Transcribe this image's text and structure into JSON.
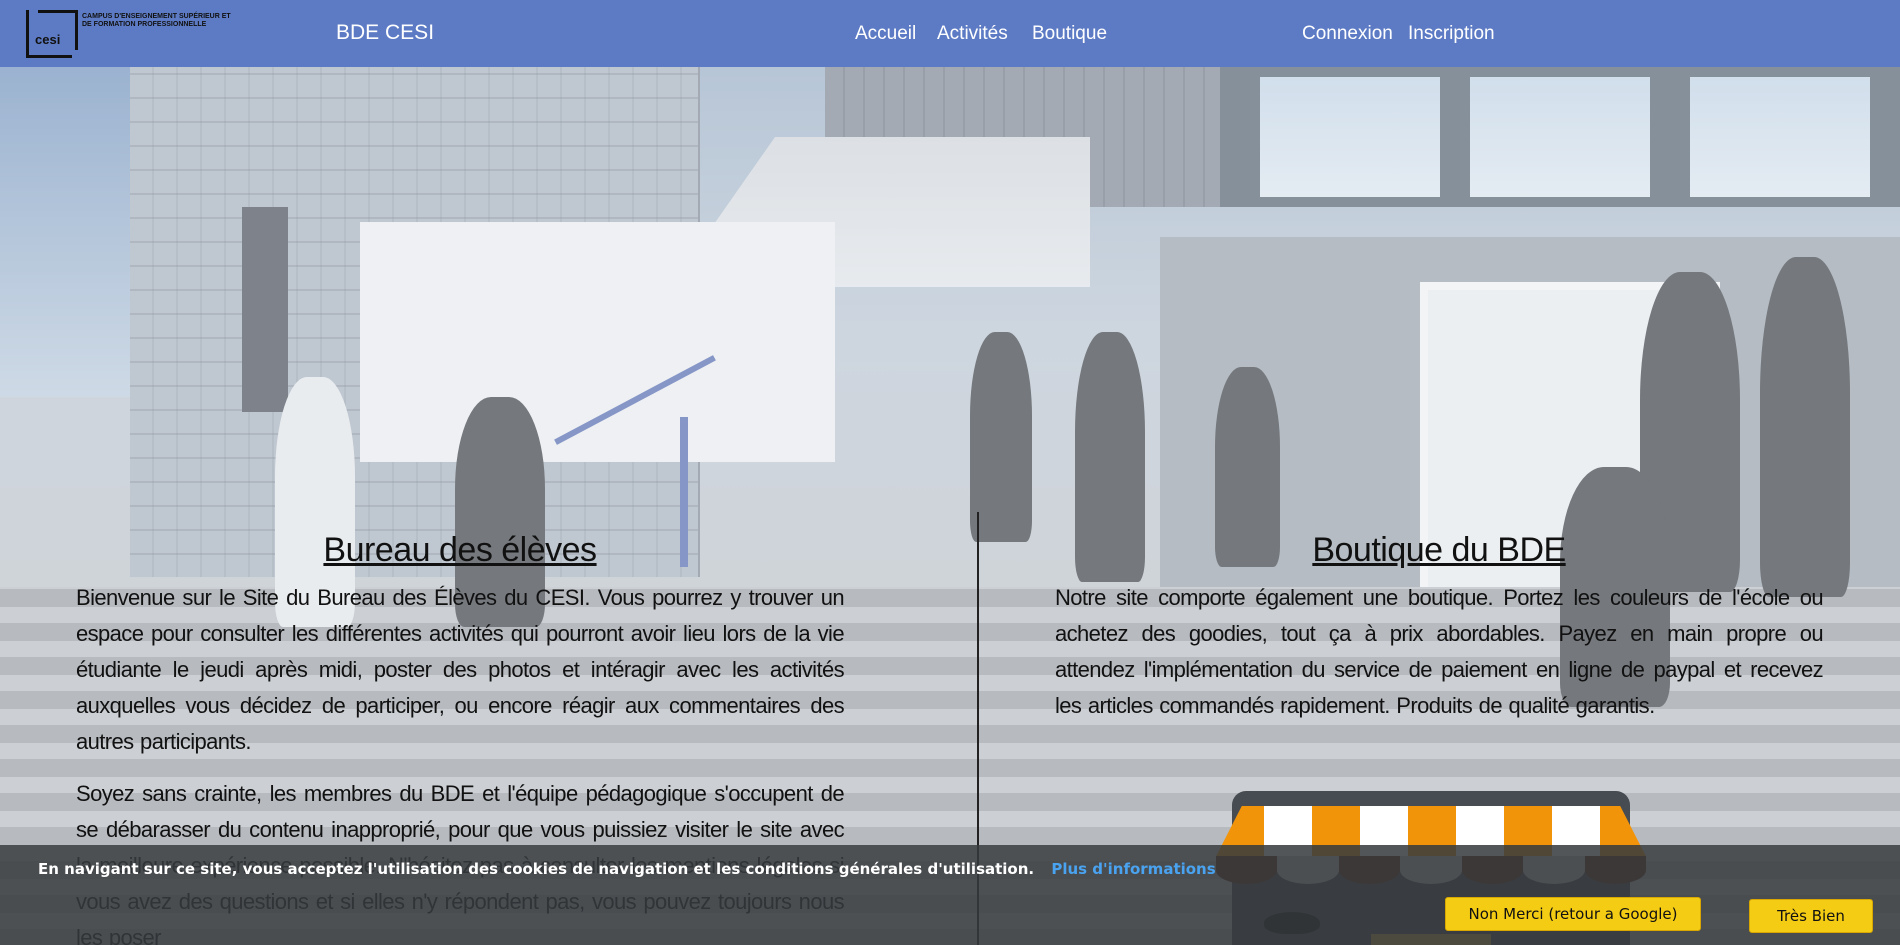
{
  "header": {
    "logo_word": "cesi",
    "logo_tagline": "Campus d'enseignement supérieur et de formation professionnelle",
    "brand": "BDE CESI",
    "nav": {
      "accueil": "Accueil",
      "activites": "Activités",
      "boutique": "Boutique",
      "connexion": "Connexion",
      "inscription": "Inscription"
    }
  },
  "left": {
    "title": "Bureau des élèves",
    "p1": "Bienvenue sur le Site du Bureau des Élèves du CESI. Vous pourrez y trouver un espace pour consulter les différentes activités qui pourront avoir lieu lors de la vie étudiante le jeudi après midi, poster des photos et intéragir avec les activités auxquelles vous décidez de participer, ou encore réagir aux commentaires des autres participants.",
    "p2": "Soyez sans crainte, les membres du BDE et l'équipe pédagogique s'occupent de se débarasser du contenu inapproprié, pour que vous puissiez visiter le site avec la meilleure expérience possible. N'hésitez pas à consulter les mentions légales si vous avez des questions et si elles n'y répondent pas, vous pouvez toujours nous les poser"
  },
  "right": {
    "title": "Boutique du BDE",
    "p1": "Notre site comporte également une boutique. Portez les couleurs de l'école ou achetez des goodies, tout ça à prix abordables. Payez en main propre ou attendez l'implémentation du service de paiement en ligne de paypal et recevez les articles commandés rapidement. Produits de qualité garantis."
  },
  "cookie": {
    "message": "En navigant sur ce site, vous acceptez l'utilisation des cookies de navigation et les conditions générales d'utilisation.",
    "more_link": "Plus d'informations",
    "decline": "Non Merci (retour a Google)",
    "accept": "Très Bien"
  },
  "colors": {
    "header_bg": "#5d7bc4",
    "cookie_button": "#f5cc14",
    "cookie_link": "#4aa3f0"
  }
}
